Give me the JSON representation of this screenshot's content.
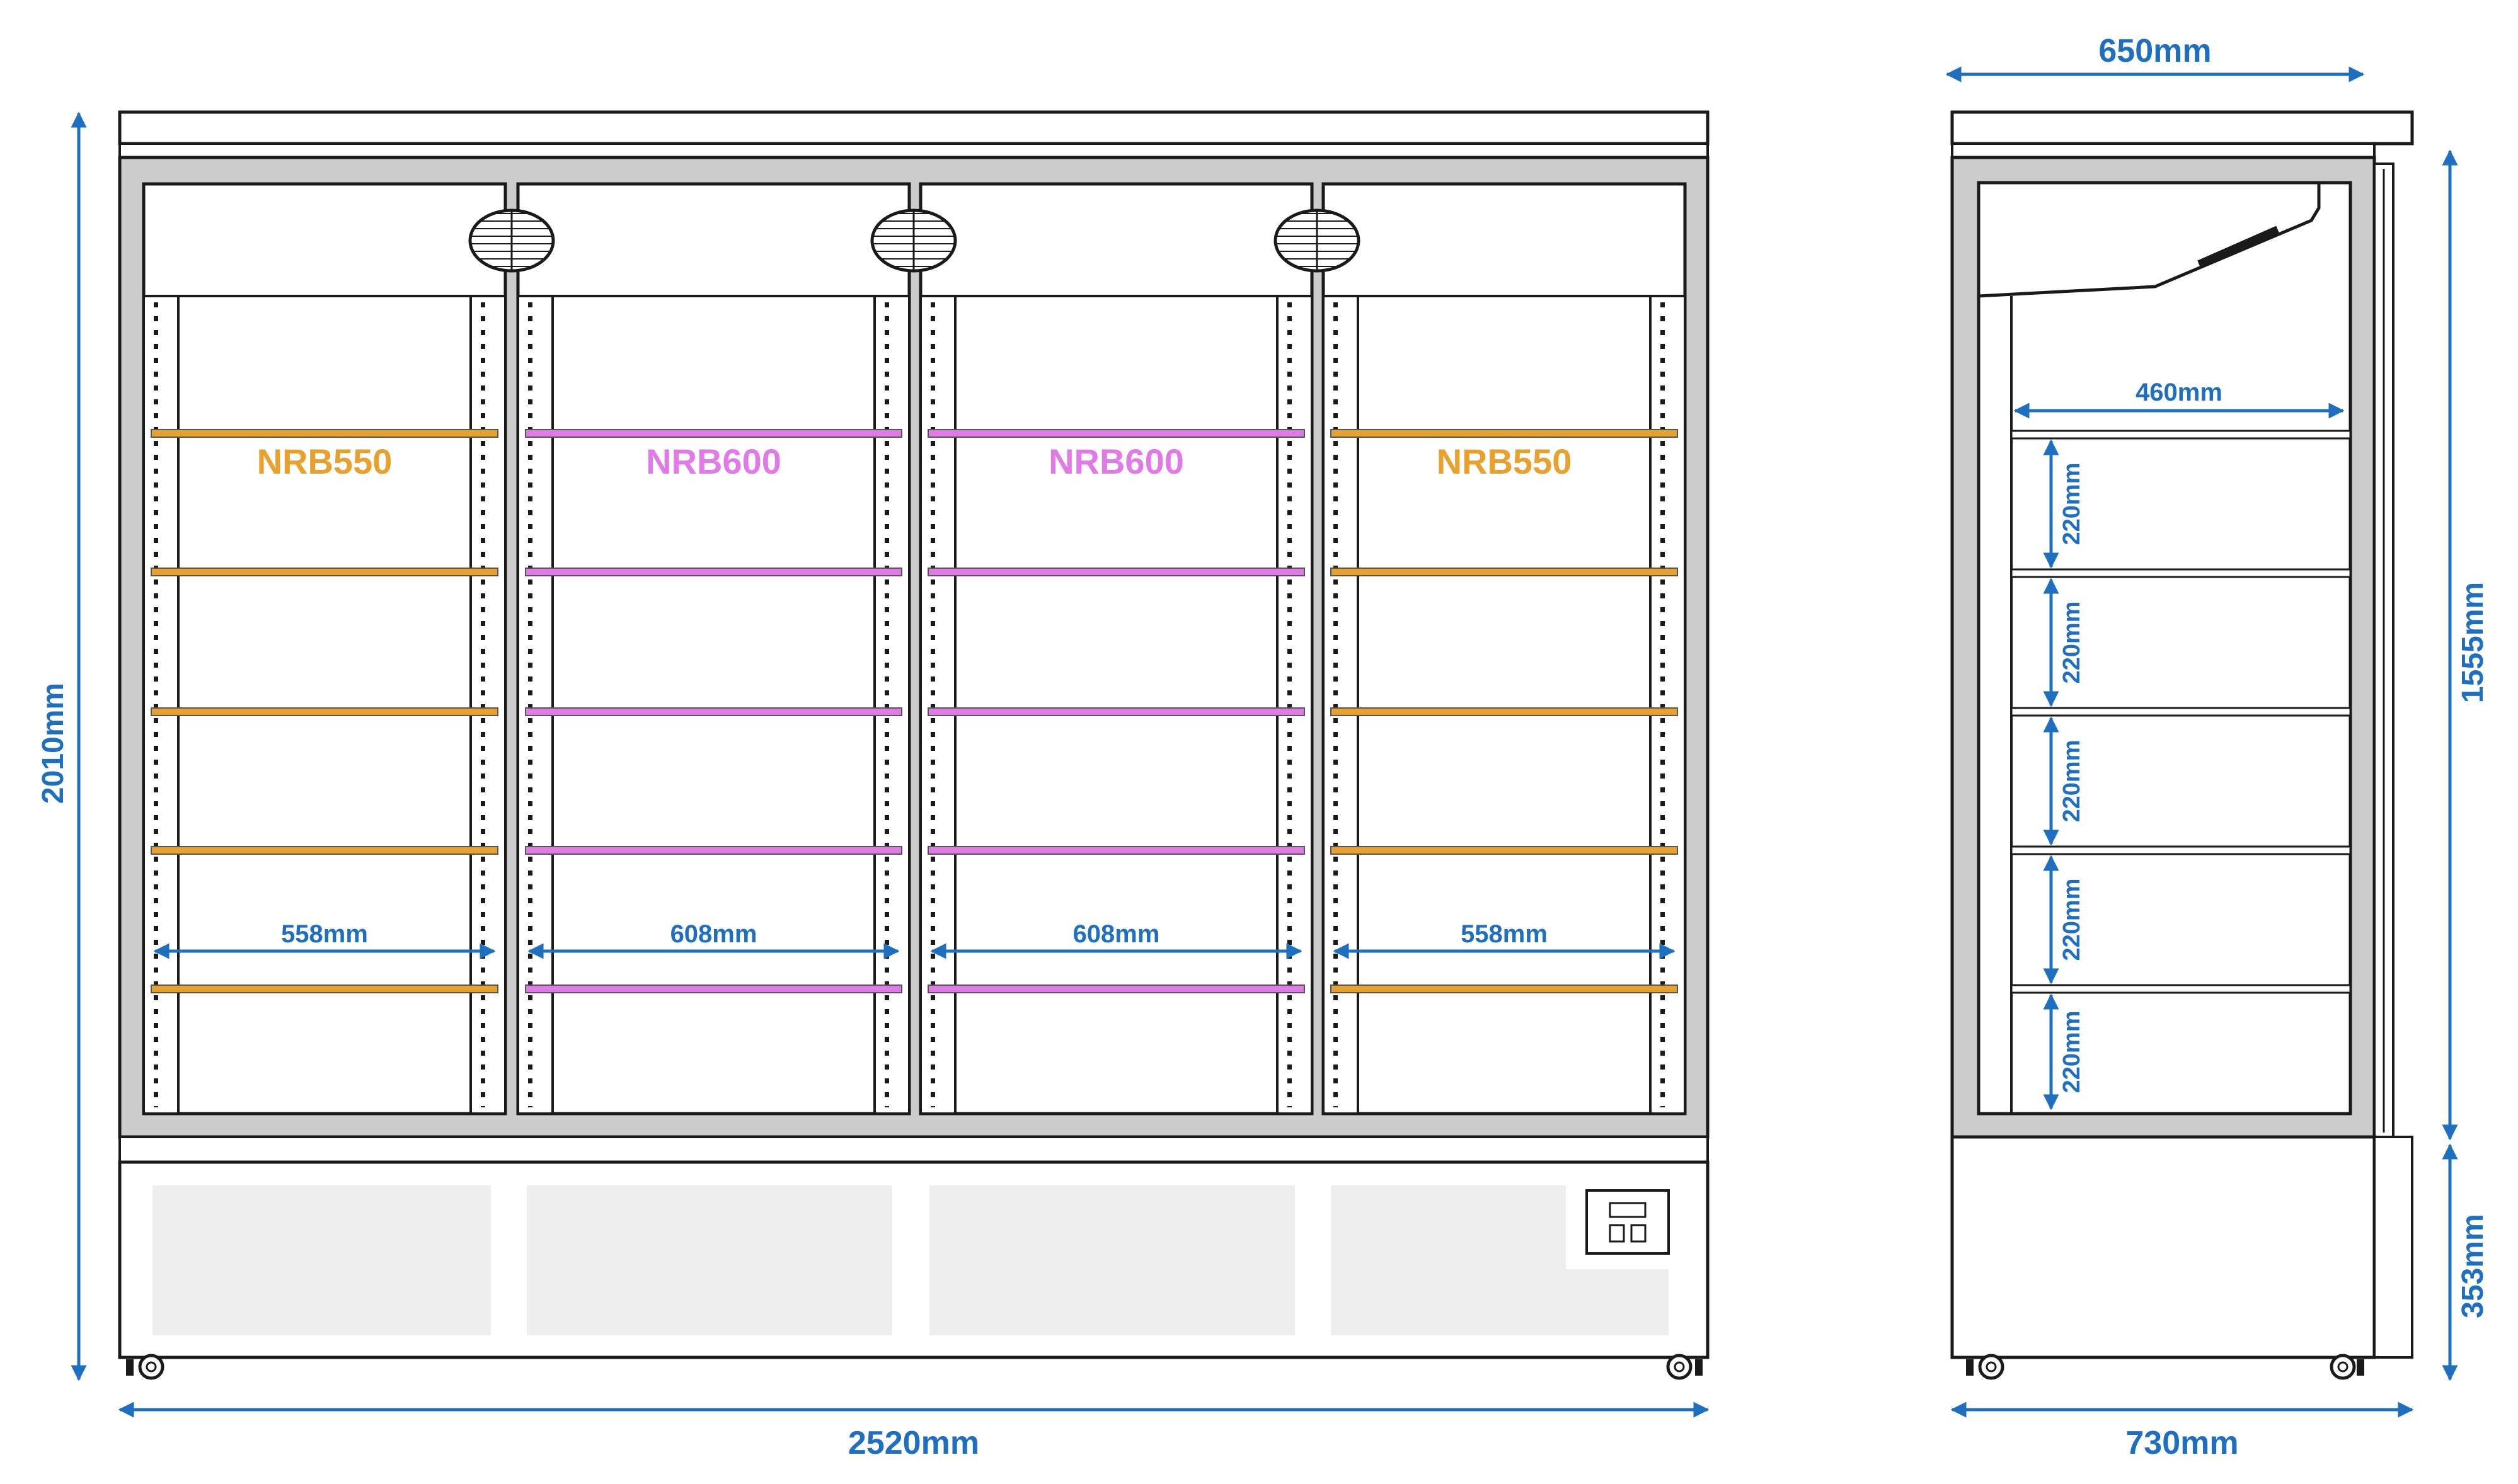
{
  "colors": {
    "dimension": "#1e6fc0",
    "nrb550": "#e8a12c",
    "nrb600": "#e07ae6",
    "frame": "#cccccc",
    "outline": "#1a1a1a",
    "panel": "#eeeeee"
  },
  "front_view": {
    "total_width": "2520mm",
    "total_height": "2010mm",
    "doors": [
      {
        "model": "NRB550",
        "shelf_width": "558mm",
        "color_key": "nrb550"
      },
      {
        "model": "NRB600",
        "shelf_width": "608mm",
        "color_key": "nrb600"
      },
      {
        "model": "NRB600",
        "shelf_width": "608mm",
        "color_key": "nrb600"
      },
      {
        "model": "NRB550",
        "shelf_width": "558mm",
        "color_key": "nrb550"
      }
    ],
    "shelves_per_door": 5,
    "icons": [
      "fan-icon",
      "control-panel-icon",
      "caster-wheel-icon"
    ]
  },
  "side_view": {
    "depth_top": "650mm",
    "depth_bottom": "730mm",
    "cabinet_height": "1555mm",
    "base_height": "353mm",
    "shelf_depth": "460mm",
    "shelf_spacing": [
      "220mm",
      "220mm",
      "220mm",
      "220mm",
      "220mm"
    ]
  }
}
